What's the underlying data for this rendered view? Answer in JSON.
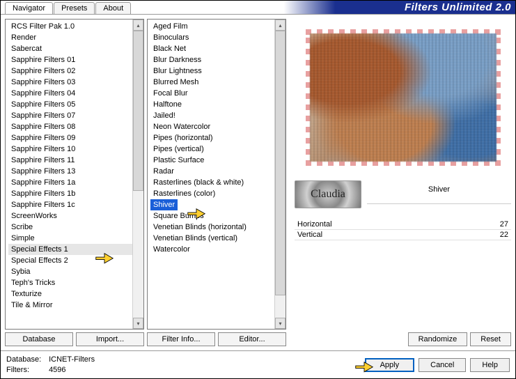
{
  "app_title": "Filters Unlimited 2.0",
  "tabs": [
    "Navigator",
    "Presets",
    "About"
  ],
  "categories": [
    "RCS Filter Pak 1.0",
    "Render",
    "Sabercat",
    "Sapphire Filters 01",
    "Sapphire Filters 02",
    "Sapphire Filters 03",
    "Sapphire Filters 04",
    "Sapphire Filters 05",
    "Sapphire Filters 07",
    "Sapphire Filters 08",
    "Sapphire Filters 09",
    "Sapphire Filters 10",
    "Sapphire Filters 11",
    "Sapphire Filters 13",
    "Sapphire Filters 1a",
    "Sapphire Filters 1b",
    "Sapphire Filters 1c",
    "ScreenWorks",
    "Scribe",
    "Simple",
    "Special Effects 1",
    "Special Effects 2",
    "Sybia",
    "Teph's Tricks",
    "Texturize",
    "Tile & Mirror"
  ],
  "selected_category_index": 20,
  "filters": [
    "Aged Film",
    "Binoculars",
    "Black Net",
    "Blur Darkness",
    "Blur Lightness",
    "Blurred Mesh",
    "Focal Blur",
    "Halftone",
    "Jailed!",
    "Neon Watercolor",
    "Pipes (horizontal)",
    "Pipes (vertical)",
    "Plastic Surface",
    "Radar",
    "Rasterlines (black & white)",
    "Rasterlines (color)",
    "Shiver",
    "Square Bumps",
    "Venetian Blinds (horizontal)",
    "Venetian Blinds (vertical)",
    "Watercolor"
  ],
  "selected_filter_index": 16,
  "buttons": {
    "database": "Database",
    "import": "Import...",
    "filter_info": "Filter Info...",
    "editor": "Editor...",
    "randomize": "Randomize",
    "reset": "Reset",
    "apply": "Apply",
    "cancel": "Cancel",
    "help": "Help"
  },
  "current_filter_name": "Shiver",
  "logo_text": "Claudia",
  "params": [
    {
      "name": "Horizontal",
      "value": "27"
    },
    {
      "name": "Vertical",
      "value": "22"
    }
  ],
  "status": {
    "db_label": "Database:",
    "db_value": "ICNET-Filters",
    "filters_label": "Filters:",
    "filters_value": "4596"
  }
}
